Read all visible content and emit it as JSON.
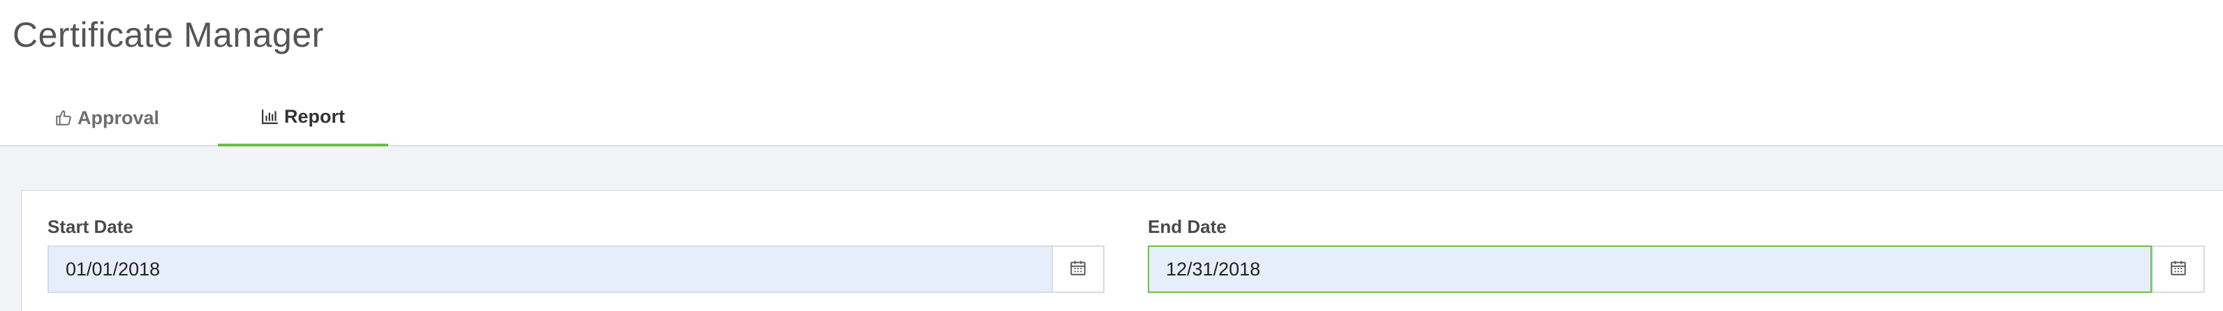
{
  "app": {
    "title": "Certificate Manager"
  },
  "tabs": [
    {
      "label": "Approval",
      "icon": "thumbs-up-icon",
      "active": false
    },
    {
      "label": "Report",
      "icon": "bar-chart-icon",
      "active": true
    }
  ],
  "report": {
    "start_date": {
      "label": "Start Date",
      "value": "01/01/2018",
      "icon": "calendar-icon"
    },
    "end_date": {
      "label": "End Date",
      "value": "12/31/2018",
      "icon": "calendar-icon",
      "focused": true
    }
  },
  "colors": {
    "accent": "#6cbf45",
    "input_background": "#e6eefc",
    "content_background": "#f2f3f7",
    "title_text": "#555555"
  }
}
